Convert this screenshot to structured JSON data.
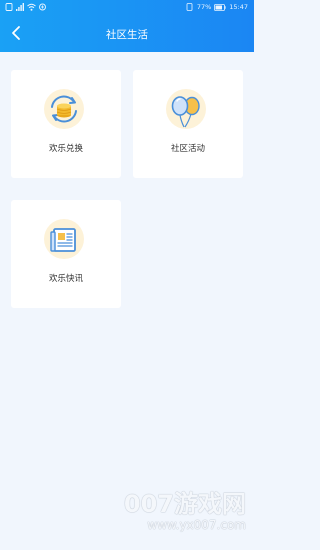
{
  "status_bar": {
    "battery": "77%",
    "time": "15:47"
  },
  "header": {
    "title": "社区生活",
    "back_icon": "chevron-left-icon"
  },
  "cards": [
    {
      "label": "欢乐兑换",
      "icon": "coin-exchange-icon"
    },
    {
      "label": "社区活动",
      "icon": "balloons-icon"
    },
    {
      "label": "欢乐快讯",
      "icon": "newspaper-icon"
    }
  ],
  "watermark": {
    "line1": "007游戏网",
    "line2": "www.yx007.com"
  },
  "colors": {
    "header_start": "#1aa1f5",
    "header_end": "#1b86f3",
    "background": "#f1f6fd",
    "icon_circle": "#fdf2d8"
  }
}
